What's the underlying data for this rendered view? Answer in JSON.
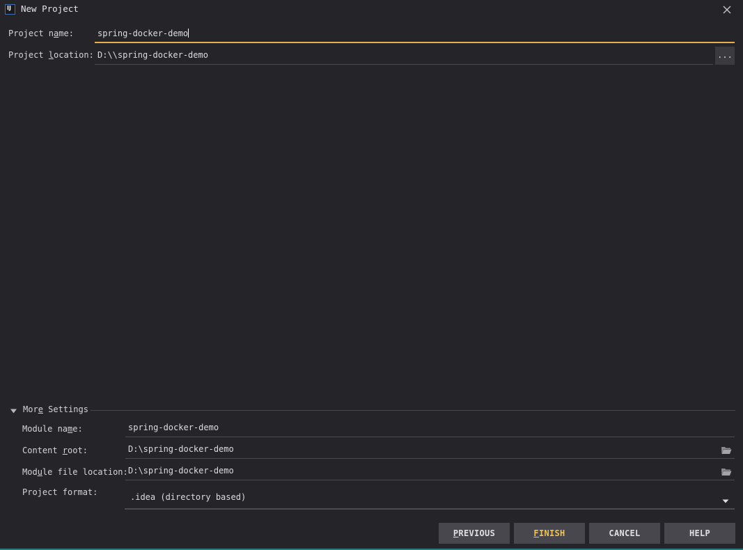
{
  "window": {
    "title": "New Project",
    "logo_text": "IJ"
  },
  "project": {
    "name_label_pre": "Project n",
    "name_label_mn": "a",
    "name_label_post": "me:",
    "name_value": "spring-docker-demo",
    "location_label_pre": "Project ",
    "location_label_mn": "l",
    "location_label_post": "ocation:",
    "location_value": "D:\\\\spring-docker-demo",
    "browse_label": "..."
  },
  "more_settings": {
    "title_pre": "Mor",
    "title_mn": "e",
    "title_post": " Settings",
    "module_name_label_pre": "Module na",
    "module_name_label_mn": "m",
    "module_name_label_post": "e:",
    "module_name_value": "spring-docker-demo",
    "content_root_label_pre": "Content ",
    "content_root_label_mn": "r",
    "content_root_label_post": "oot:",
    "content_root_value": "D:\\spring-docker-demo",
    "module_file_label_pre": "Mod",
    "module_file_label_mn": "u",
    "module_file_label_post": "le file location:",
    "module_file_value": "D:\\spring-docker-demo",
    "format_label": "Project format:",
    "format_value": ".idea (directory based)"
  },
  "buttons": {
    "previous_mn": "P",
    "previous_rest": "REVIOUS",
    "finish_mn": "F",
    "finish_rest": "INISH",
    "cancel": "CANCEL",
    "help": "HELP"
  },
  "colors": {
    "background": "#252428",
    "focus_accent": "#e8b04c",
    "primary_button_text": "#f2c14e",
    "button_bg": "#48474d"
  },
  "icons": {
    "logo": "intellij-logo-icon",
    "close": "close-icon",
    "collapse": "triangle-down-icon",
    "folder": "folder-icon",
    "dropdown": "chevron-down-icon"
  }
}
